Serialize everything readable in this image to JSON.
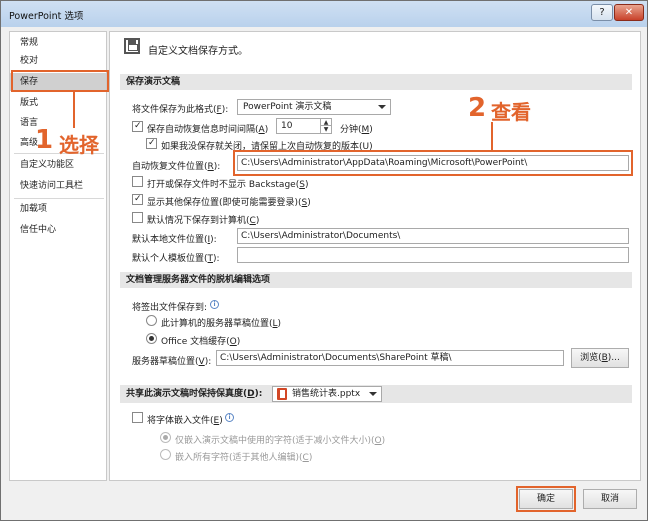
{
  "window": {
    "title": "PowerPoint 选项",
    "help": "?",
    "close": "✕"
  },
  "sidebar": {
    "items": [
      "常规",
      "校对",
      "保存",
      "版式",
      "语言",
      "高级",
      "自定义功能区",
      "快速访问工具栏",
      "加载项",
      "信任中心"
    ],
    "active_index": 2
  },
  "annotations": {
    "step1_num": "1",
    "step1_text": "选择",
    "step2_num": "2",
    "step2_text": "查看",
    "color": "#e2642c"
  },
  "header": {
    "title": "自定义文档保存方式。"
  },
  "save_section": {
    "title": "保存演示文稿",
    "format_label": "将文件保存为此格式(",
    "format_key": "F",
    "format_value": "PowerPoint 演示文稿",
    "autorecover_label": "保存自动恢复信息时间间隔(",
    "autorecover_key": "A",
    "autorecover_value": "10",
    "minutes_label": "分钟(",
    "minutes_key": "M",
    "keep_last_label": "如果我没保存就关闭，请保留上次自动恢复的版本(",
    "keep_last_key": "U",
    "ar_location_label": "自动恢复文件位置(",
    "ar_location_key": "R",
    "ar_location_value": "C:\\Users\\Administrator\\AppData\\Roaming\\Microsoft\\PowerPoint\\",
    "no_backstage_label": "打开或保存文件时不显示 Backstage(",
    "no_backstage_key": "S",
    "show_other_label": "显示其他保存位置(即使可能需要登录)(",
    "show_other_key": "S",
    "default_local_label": "默认情况下保存到计算机(",
    "default_local_key": "C",
    "local_location_label": "默认本地文件位置(",
    "local_location_key": "I",
    "local_location_value": "C:\\Users\\Administrator\\Documents\\",
    "template_location_label": "默认个人模板位置(",
    "template_location_key": "T",
    "template_location_value": ""
  },
  "server_section": {
    "title": "文档管理服务器文件的脱机编辑选项",
    "checkout_label": "将签出文件保存到:",
    "opt_server_label": "此计算机的服务器草稿位置(",
    "opt_server_key": "L",
    "opt_cache_label": "Office 文档缓存(",
    "opt_cache_key": "O",
    "drafts_label": "服务器草稿位置(",
    "drafts_key": "V",
    "drafts_value": "C:\\Users\\Administrator\\Documents\\SharePoint 草稿\\",
    "browse_label": "浏览(",
    "browse_key": "B",
    "browse_suffix": ")..."
  },
  "fidelity_section": {
    "title_label": "共享此演示文稿时保持保真度(",
    "title_key": "D",
    "file_value": "销售统计表.pptx",
    "embed_label": "将字体嵌入文件(",
    "embed_key": "E",
    "embed_used_label": "仅嵌入演示文稿中使用的字符(适于减小文件大小)(",
    "embed_used_key": "O",
    "embed_all_label": "嵌入所有字符(适于其他人编辑)(",
    "embed_all_key": "C"
  },
  "footer": {
    "ok_label": "确定",
    "cancel_label": "取消"
  }
}
